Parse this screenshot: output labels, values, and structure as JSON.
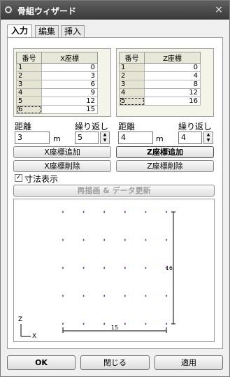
{
  "window": {
    "title": "骨組ウィザード",
    "close": "×"
  },
  "tabs": [
    "入力",
    "編集",
    "挿入"
  ],
  "x_table": {
    "headers": [
      "番号",
      "X座標"
    ],
    "rows": [
      [
        "1",
        "0"
      ],
      [
        "2",
        "3"
      ],
      [
        "3",
        "6"
      ],
      [
        "4",
        "9"
      ],
      [
        "5",
        "12"
      ],
      [
        "6",
        "15"
      ]
    ]
  },
  "z_table": {
    "headers": [
      "番号",
      "Z座標"
    ],
    "rows": [
      [
        "1",
        "0"
      ],
      [
        "2",
        "4"
      ],
      [
        "3",
        "8"
      ],
      [
        "4",
        "12"
      ],
      [
        "5",
        "16"
      ]
    ]
  },
  "x_controls": {
    "distance_label": "距離",
    "distance_value": "3",
    "unit": "m",
    "repeat_label": "繰り返し",
    "repeat_value": "5"
  },
  "z_controls": {
    "distance_label": "距離",
    "distance_value": "4",
    "unit": "m",
    "repeat_label": "繰り返し",
    "repeat_value": "4"
  },
  "buttons": {
    "add_x": "X座標追加",
    "delete_x": "X座標削除",
    "add_z": "Z座標追加",
    "delete_z": "Z座標削除",
    "redraw": "再描画 & データ更新",
    "ok": "OK",
    "close": "閉じる",
    "apply": "適用"
  },
  "show_dims": {
    "label": "寸法表示",
    "checked": true
  },
  "preview": {
    "x_dim": "15",
    "z_dim": "16",
    "axis_z": "Z",
    "axis_x": "X",
    "point_color": "#7b1fa2"
  }
}
